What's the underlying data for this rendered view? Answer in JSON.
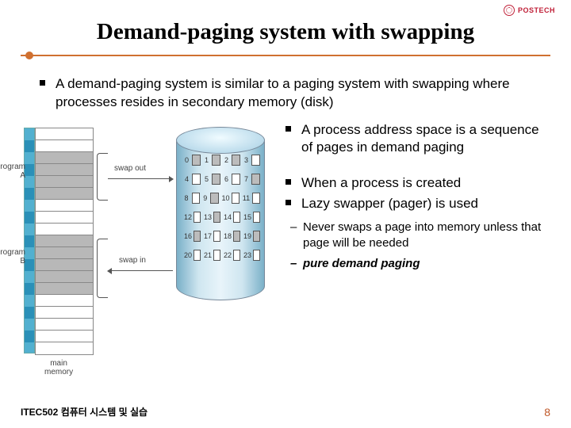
{
  "brand": {
    "name": "POSTECH"
  },
  "title": "Demand-paging system with swapping",
  "intro": "A demand-paging system is similar to a paging system with swapping where processes resides in secondary memory (disk)",
  "figure": {
    "program_a_label": "program\nA",
    "program_b_label": "program\nB",
    "swap_out_label": "swap out",
    "swap_in_label": "swap in",
    "main_memory_label": "main\nmemory",
    "page_numbers": [
      "0",
      "1",
      "2",
      "3",
      "4",
      "5",
      "6",
      "7",
      "8",
      "9",
      "10",
      "11",
      "12",
      "13",
      "14",
      "15",
      "16",
      "17",
      "18",
      "19",
      "20",
      "21",
      "22",
      "23"
    ]
  },
  "bullets": {
    "b1": "A process address space is a sequence of pages in demand paging",
    "b2": "When a process is created",
    "b3": "Lazy swapper (pager) is used",
    "s1": "Never swaps a page into memory unless that page will be needed",
    "s2": "pure demand paging"
  },
  "footer": {
    "course": "ITEC502 컴퓨터 시스템 및 실습",
    "page": "8"
  }
}
